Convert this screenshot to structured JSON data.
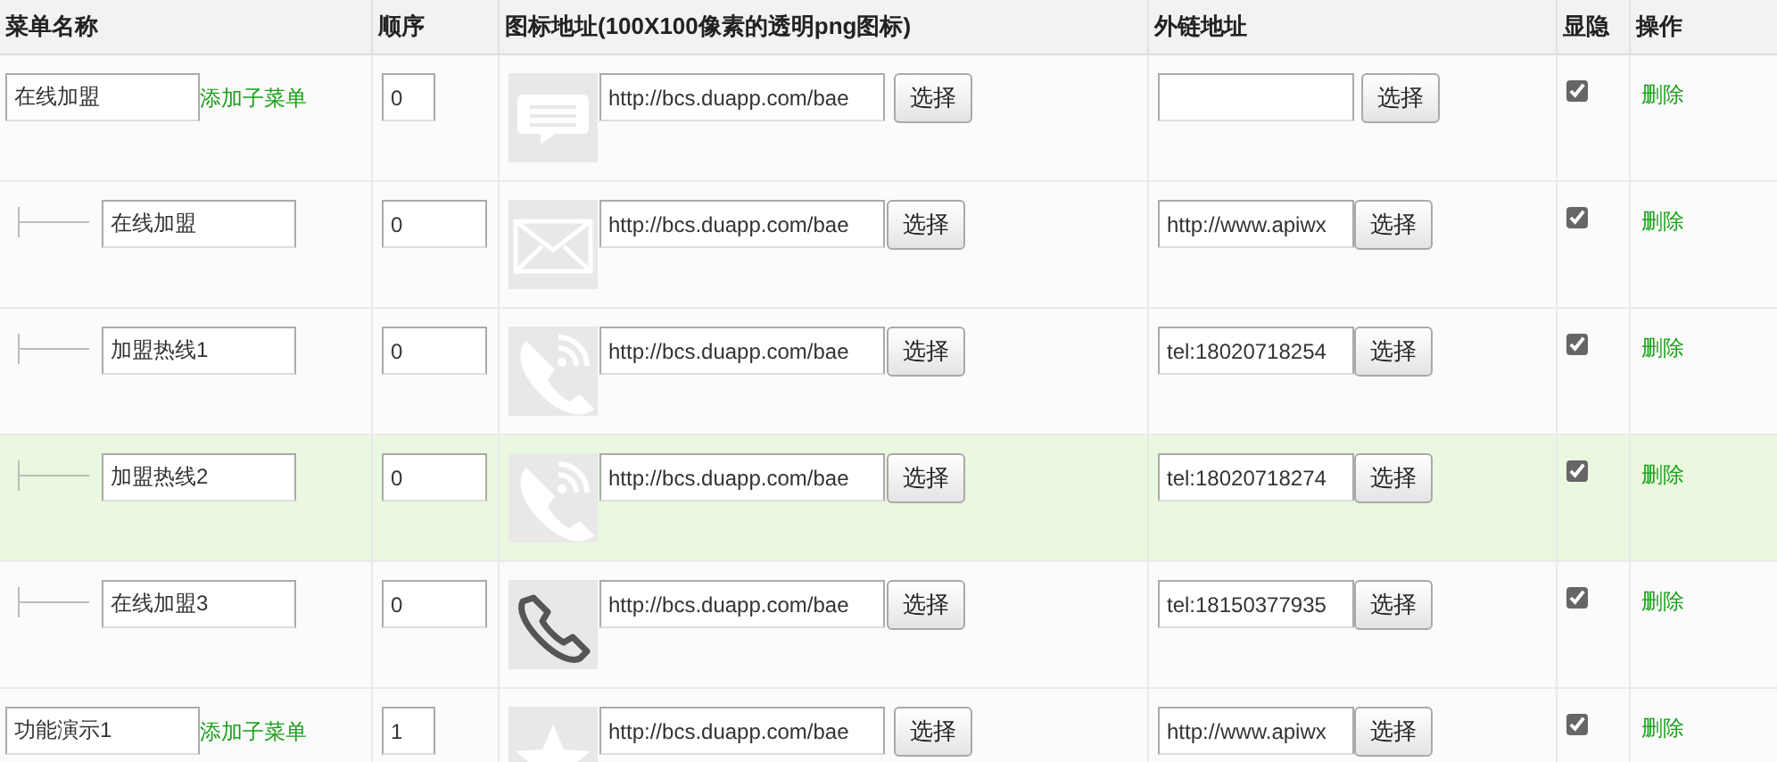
{
  "columns": [
    "菜单名称",
    "顺序",
    "图标地址(100X100像素的透明png图标)",
    "外链地址",
    "显隐",
    "操作"
  ],
  "rows": [
    {
      "kind": "top",
      "name": "在线加盟",
      "add_child": "添加子菜单",
      "order": "0",
      "icon": {
        "kind": "chat"
      },
      "icon_url": "http://bcs.duapp.com/bae",
      "icon_button": "选择",
      "link": "",
      "link_button": "选择",
      "visible": true,
      "delete": "删除",
      "highlighted": false
    },
    {
      "kind": "child",
      "name": "在线加盟",
      "order": "0",
      "icon": {
        "kind": "mail"
      },
      "icon_url": "http://bcs.duapp.com/bae",
      "icon_button": "选择",
      "link": "http://www.apiwx",
      "link_button": "选择",
      "visible": true,
      "delete": "删除",
      "highlighted": false
    },
    {
      "kind": "child",
      "name": "加盟热线1",
      "order": "0",
      "icon": {
        "kind": "phone-wave"
      },
      "icon_url": "http://bcs.duapp.com/bae",
      "icon_button": "选择",
      "link": "tel:18020718254",
      "link_button": "选择",
      "visible": true,
      "delete": "删除",
      "highlighted": false
    },
    {
      "kind": "child",
      "name": "加盟热线2",
      "order": "0",
      "icon": {
        "kind": "phone-wave"
      },
      "icon_url": "http://bcs.duapp.com/bae",
      "icon_button": "选择",
      "link": "tel:18020718274",
      "link_button": "选择",
      "visible": true,
      "delete": "删除",
      "highlighted": true
    },
    {
      "kind": "child",
      "name": "在线加盟3",
      "order": "0",
      "icon": {
        "kind": "phone"
      },
      "icon_url": "http://bcs.duapp.com/bae",
      "icon_button": "选择",
      "link": "tel:18150377935",
      "link_button": "选择",
      "visible": true,
      "delete": "删除",
      "highlighted": false
    },
    {
      "kind": "top",
      "name": "功能演示1",
      "add_child": "添加子菜单",
      "order": "1",
      "icon": {
        "kind": "star"
      },
      "icon_url": "http://bcs.duapp.com/bae",
      "icon_button": "选择",
      "link": "http://www.apiwx",
      "link_button": "选择",
      "visible": true,
      "delete": "删除",
      "highlighted": false
    }
  ]
}
